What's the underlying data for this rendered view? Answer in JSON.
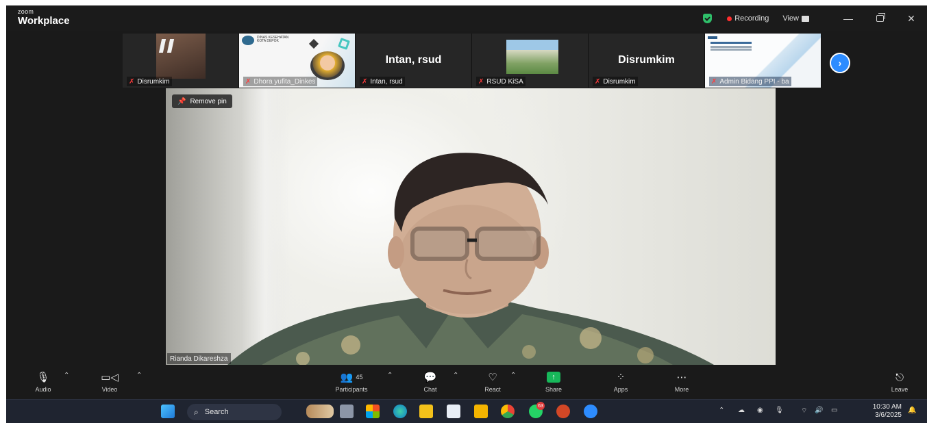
{
  "app": {
    "brand_small": "zoom",
    "brand_big": "Workplace",
    "recording_label": "Recording",
    "view_label": "View"
  },
  "thumbnails": [
    {
      "name": "Disrumkim"
    },
    {
      "name": "Dhora yufita_Dinkes",
      "doc_text": "DINAS KESEHATAN KOTA DEPOK"
    },
    {
      "name": "Intan, rsud",
      "big_label": "Intan, rsud"
    },
    {
      "name": "RSUD KiSA"
    },
    {
      "name": "Disrumkim",
      "big_label": "Disrumkim"
    },
    {
      "name": "Admin Bidang PPI - ba"
    }
  ],
  "main_video": {
    "remove_pin_label": "Remove pin",
    "participant_name": "Rianda Dikareshza"
  },
  "toolbar": {
    "audio": "Audio",
    "video": "Video",
    "participants": "Participants",
    "participants_count": "45",
    "chat": "Chat",
    "react": "React",
    "share": "Share",
    "apps": "Apps",
    "more": "More",
    "leave": "Leave"
  },
  "taskbar": {
    "search_label": "Search",
    "whatsapp_badge": "63",
    "time": "10:30 AM",
    "date": "3/6/2025"
  },
  "colors": {
    "accent_blue": "#2d8cff",
    "share_green": "#17b85a",
    "recording_red": "#ff2d2d",
    "shield_green": "#2fc06a"
  }
}
